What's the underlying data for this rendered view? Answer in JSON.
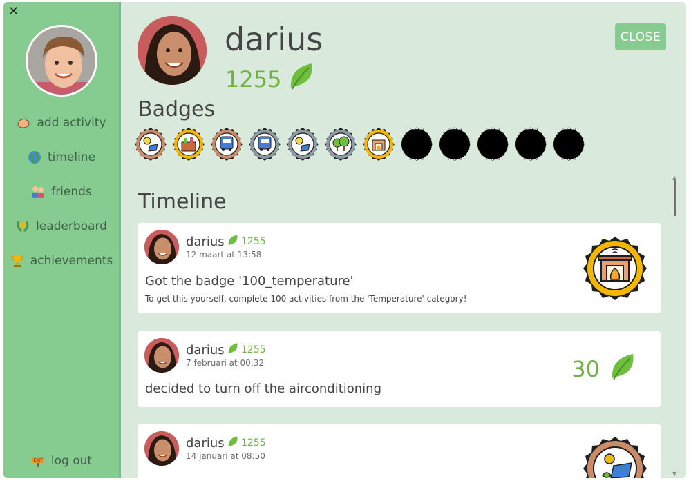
{
  "sidebar": {
    "close_glyph": "✕",
    "items": [
      {
        "label": "add activity",
        "icon": "flexed-arm-icon"
      },
      {
        "label": "timeline",
        "icon": "globe-icon"
      },
      {
        "label": "friends",
        "icon": "friends-icon"
      },
      {
        "label": "leaderboard",
        "icon": "laurel-icon"
      },
      {
        "label": "achievements",
        "icon": "trophy-icon"
      }
    ],
    "logout_label": "log out",
    "logout_icon": "exit-sign-icon"
  },
  "profile": {
    "name": "darius",
    "points": "1255",
    "close_label": "CLOSE"
  },
  "badges": {
    "heading": "Badges",
    "items": [
      {
        "kind": "solar-bulb",
        "earned": true,
        "ring": "#c98b6a"
      },
      {
        "kind": "groceries",
        "earned": true,
        "ring": "#f2b705"
      },
      {
        "kind": "transport",
        "earned": true,
        "ring": "#c98b6a"
      },
      {
        "kind": "transport",
        "earned": true,
        "ring": "#8e9aa3"
      },
      {
        "kind": "solar-bulb",
        "earned": true,
        "ring": "#8e9aa3"
      },
      {
        "kind": "trees",
        "earned": true,
        "ring": "#8e9aa3"
      },
      {
        "kind": "fireplace",
        "earned": true,
        "ring": "#f2b705"
      },
      {
        "kind": "locked",
        "earned": false
      },
      {
        "kind": "locked",
        "earned": false
      },
      {
        "kind": "locked",
        "earned": false
      },
      {
        "kind": "locked",
        "earned": false
      },
      {
        "kind": "locked",
        "earned": false
      }
    ]
  },
  "timeline": {
    "heading": "Timeline",
    "posts": [
      {
        "name": "darius",
        "points": "1255",
        "time": "12 maart at 13:58",
        "text": "Got the badge '100_temperature'",
        "subtext": "To get this yourself, complete 100 activities from the 'Temperature' category!",
        "badge": "fireplace-gold"
      },
      {
        "name": "darius",
        "points": "1255",
        "time": "7 februari at 00:32",
        "text": "decided to turn off the airconditioning",
        "reward": "30"
      },
      {
        "name": "darius",
        "points": "1255",
        "time": "14 januari at 08:50",
        "badge": "solar-bronze"
      }
    ]
  },
  "colors": {
    "sidebar": "#86cc91",
    "background": "#d9eadc",
    "accent_green": "#71b043",
    "text": "#454545"
  }
}
